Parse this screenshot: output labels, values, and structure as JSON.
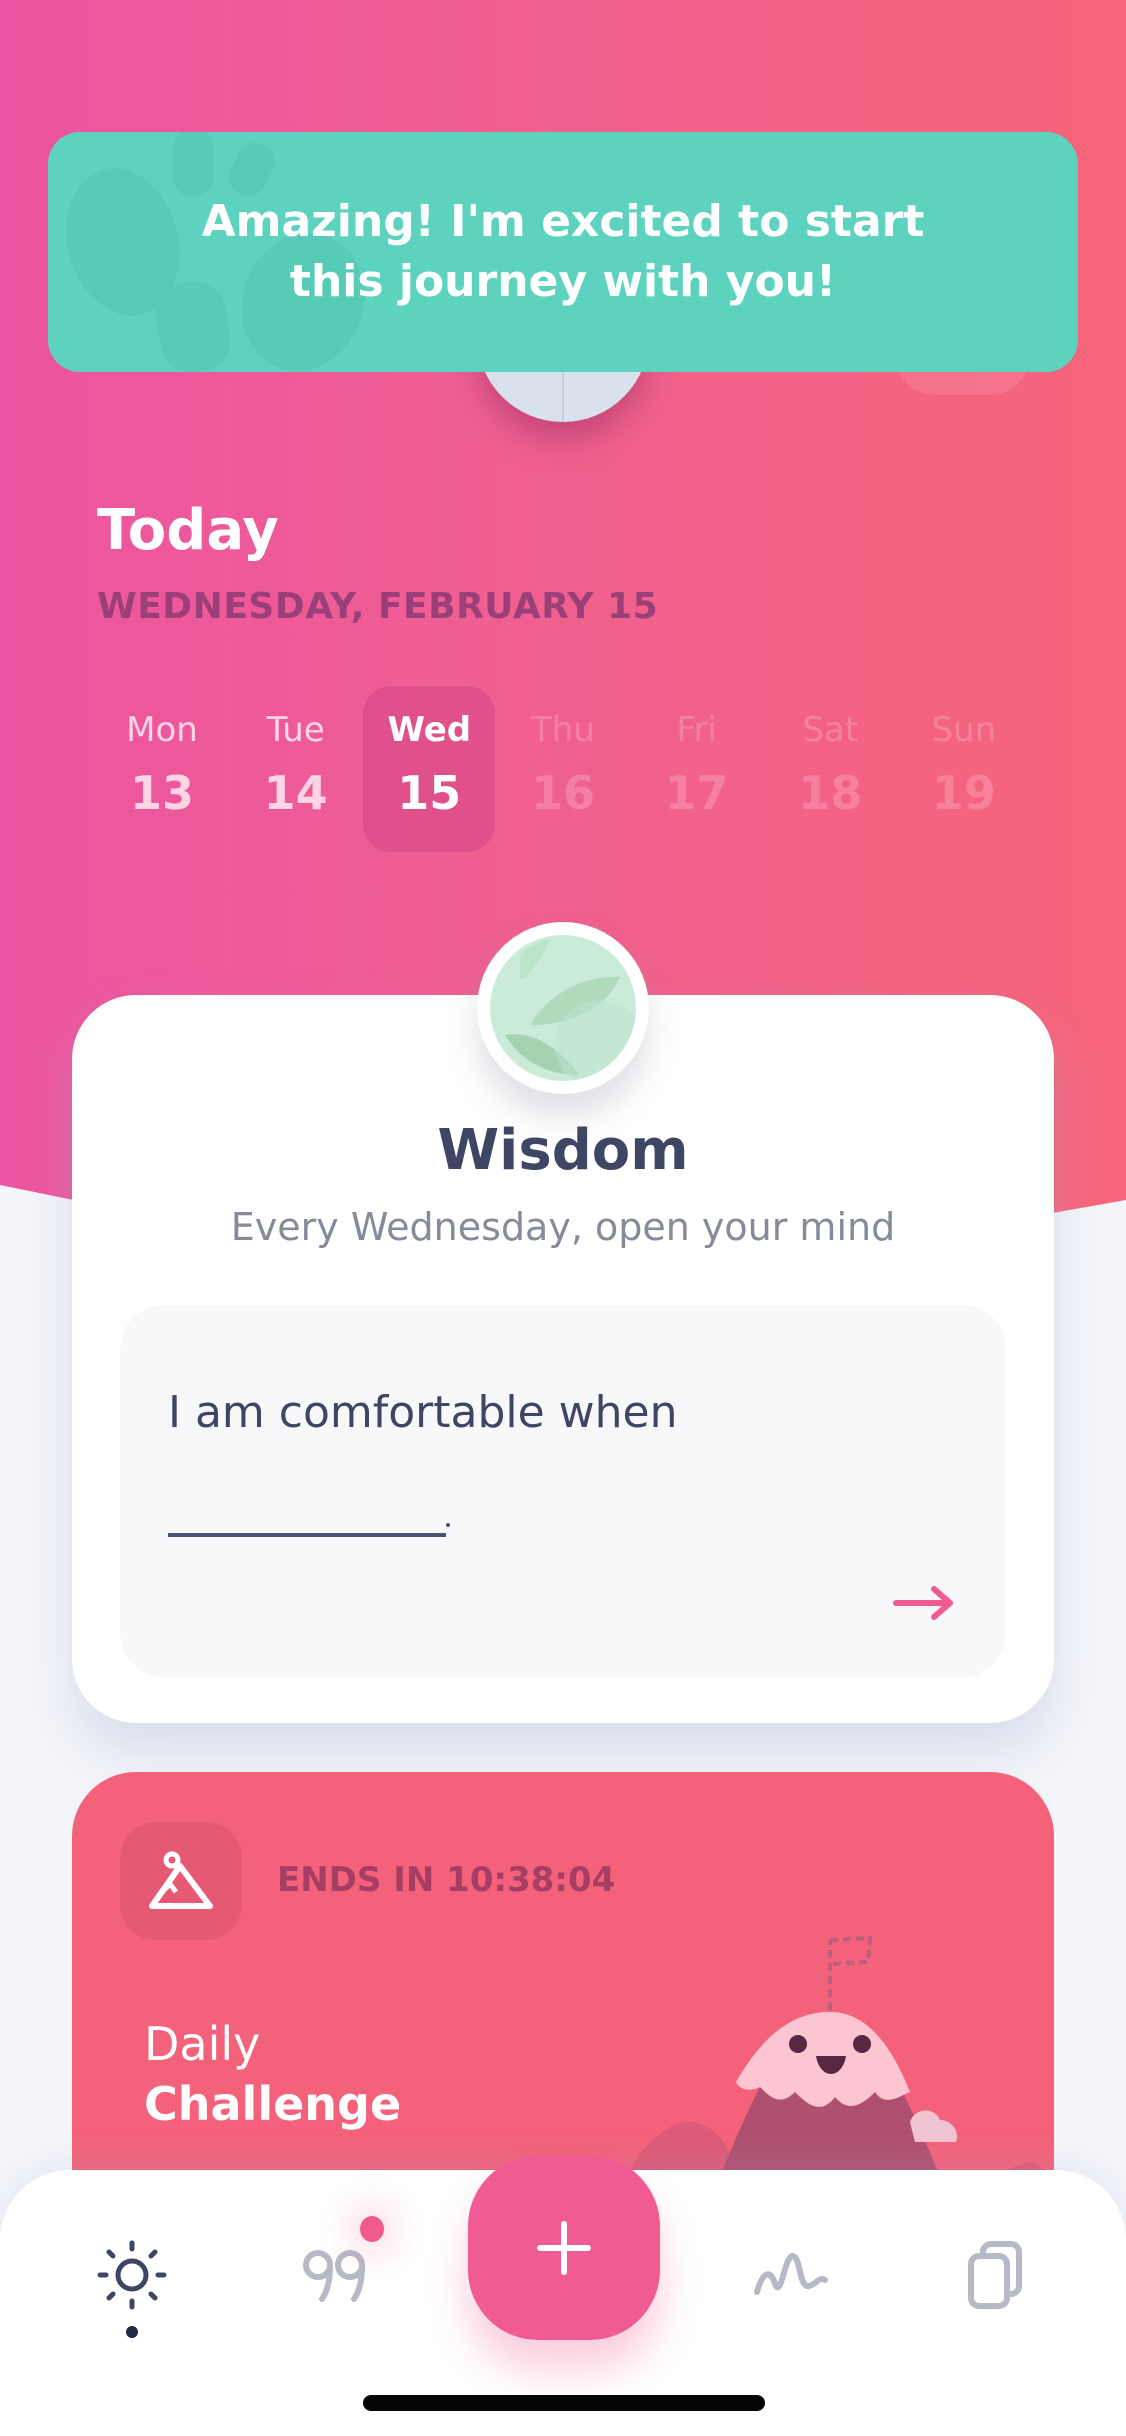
{
  "banner": {
    "message": "Amazing! I'm excited to start this journey with you!",
    "color": "#5dd3bf"
  },
  "header": {
    "title": "Today",
    "date": "WEDNESDAY, FEBRUARY 15",
    "gradient": [
      "#ec55a1",
      "#f66579"
    ]
  },
  "week": {
    "days": [
      {
        "name": "Mon",
        "num": "13",
        "state": "past"
      },
      {
        "name": "Tue",
        "num": "14",
        "state": "past"
      },
      {
        "name": "Wed",
        "num": "15",
        "state": "selected"
      },
      {
        "name": "Thu",
        "num": "16",
        "state": "future"
      },
      {
        "name": "Fri",
        "num": "17",
        "state": "future"
      },
      {
        "name": "Sat",
        "num": "18",
        "state": "future"
      },
      {
        "name": "Sun",
        "num": "19",
        "state": "future"
      }
    ]
  },
  "wisdom": {
    "title": "Wisdom",
    "subtitle": "Every Wednesday, open your mind",
    "prompt": "I am comfortable when",
    "blank_suffix": ".",
    "icon": "arrow-right-icon",
    "accent": "#ef5b92"
  },
  "challenge": {
    "ends_in": "ENDS IN 10:38:04",
    "label_line1": "Daily",
    "label_line2": "Challenge",
    "color": "#f3627a",
    "icon": "mountain-icon"
  },
  "nav": {
    "items": [
      {
        "name": "today",
        "icon": "sun-icon",
        "active": true
      },
      {
        "name": "quotes",
        "icon": "quote-icon",
        "badge": true
      },
      {
        "name": "add",
        "icon": "plus-icon"
      },
      {
        "name": "mood",
        "icon": "wave-icon"
      },
      {
        "name": "entries",
        "icon": "cards-icon"
      }
    ]
  }
}
